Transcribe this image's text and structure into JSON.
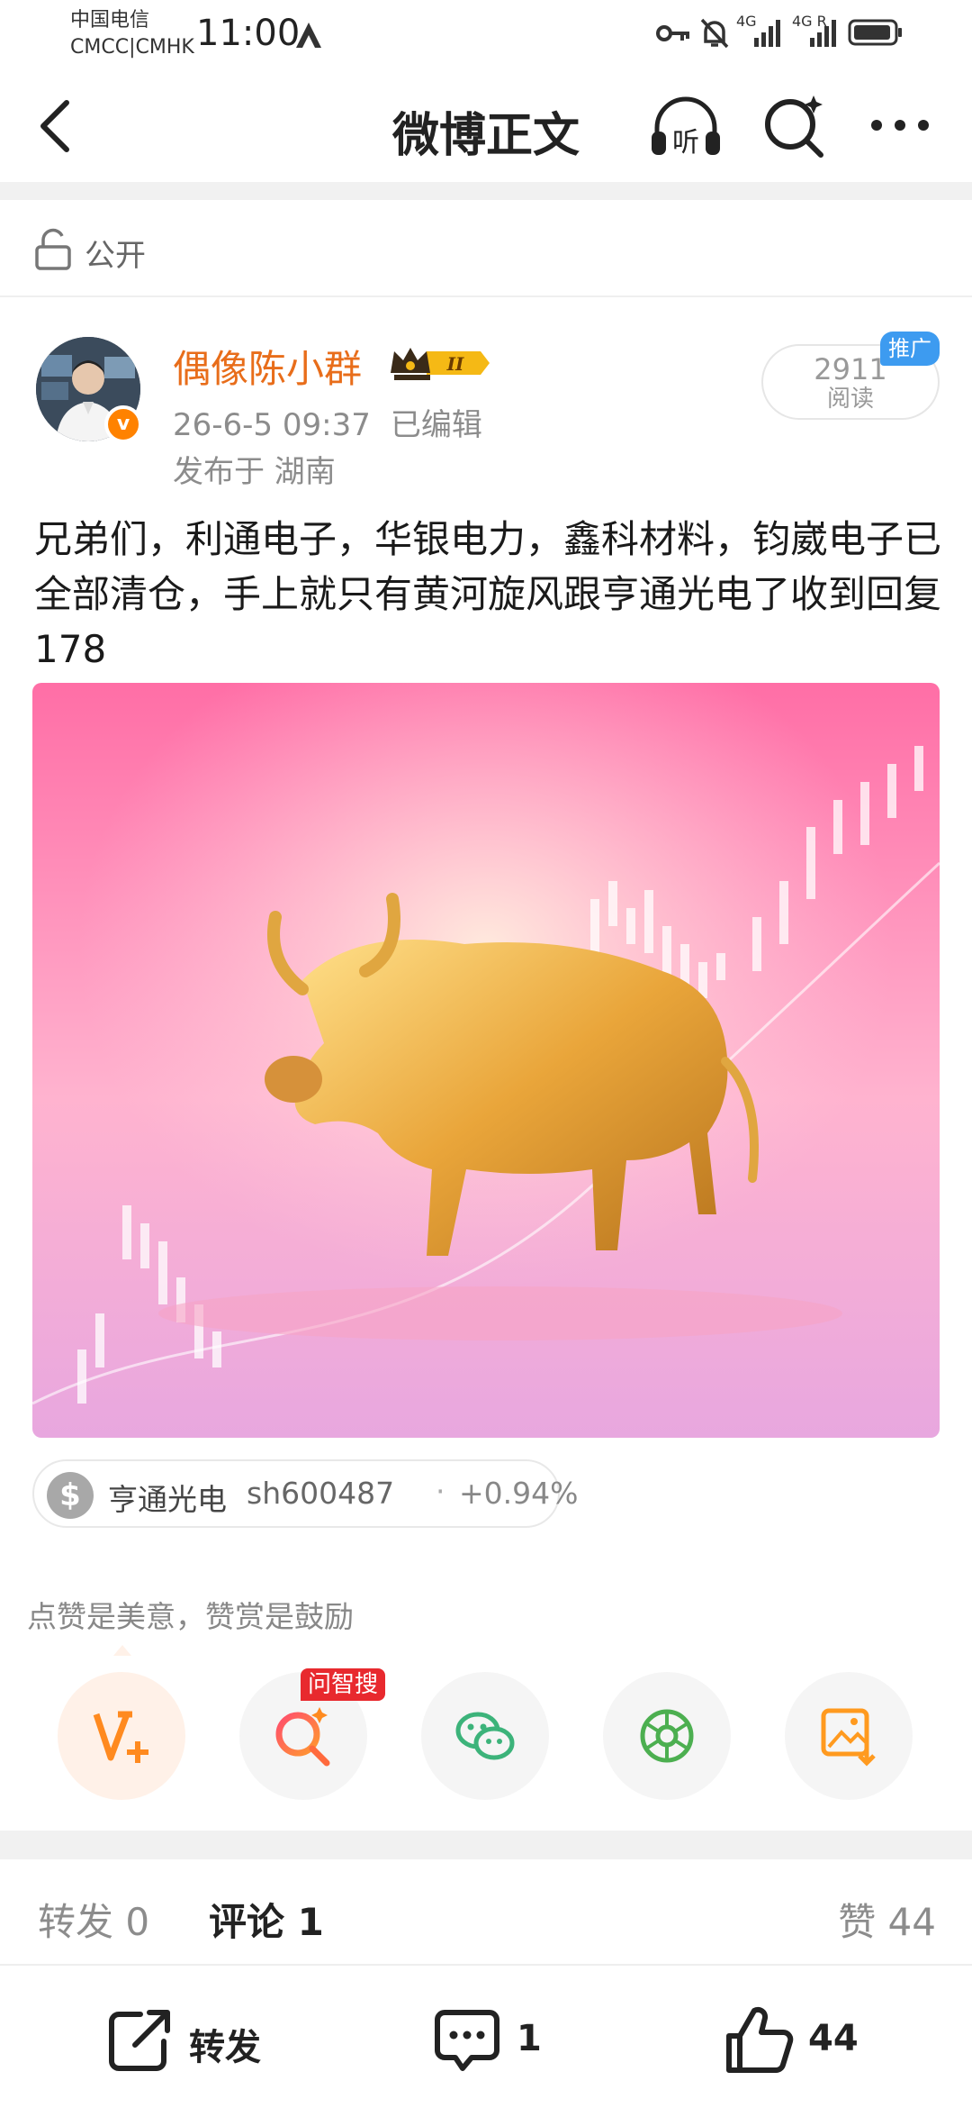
{
  "status_bar": {
    "carrier_line1": "中国电信",
    "carrier_line2": "CMCC|CMHK",
    "time": "11:00",
    "network1": "4G",
    "network2": "4G R"
  },
  "nav": {
    "title": "微博正文",
    "listen_label": "听"
  },
  "visibility": {
    "label": "公开"
  },
  "author": {
    "name": "偶像陈小群",
    "vip_level": "II",
    "date": "26-6-5 09:37",
    "edited": "已编辑",
    "location": "发布于 湖南",
    "verified_mark": "v"
  },
  "read": {
    "count": "2911",
    "label": "阅读",
    "promo_tag": "推广"
  },
  "post": {
    "text": "兄弟们，利通电子，华银电力，鑫科材料，钧崴电子已全部清仓，手上就只有黄河旋风跟亨通光电了收到回复178"
  },
  "stock": {
    "icon": "$",
    "name": "亨通光电",
    "code": "sh600487",
    "separator": "·",
    "change": "+0.94%"
  },
  "reward": {
    "hint": "点赞是美意，赞赏是鼓励",
    "ask_badge": "问智搜"
  },
  "tabs": {
    "repost": "转发 0",
    "comment": "评论 1",
    "like": "赞 44"
  },
  "bottom_bar": {
    "repost_label": "转发",
    "comment_count": "1",
    "like_count": "44"
  },
  "colors": {
    "accent_orange": "#ff8200",
    "author_name": "#e86d1a",
    "promo_blue": "#3d9bf0",
    "ask_red": "#e8292e"
  }
}
